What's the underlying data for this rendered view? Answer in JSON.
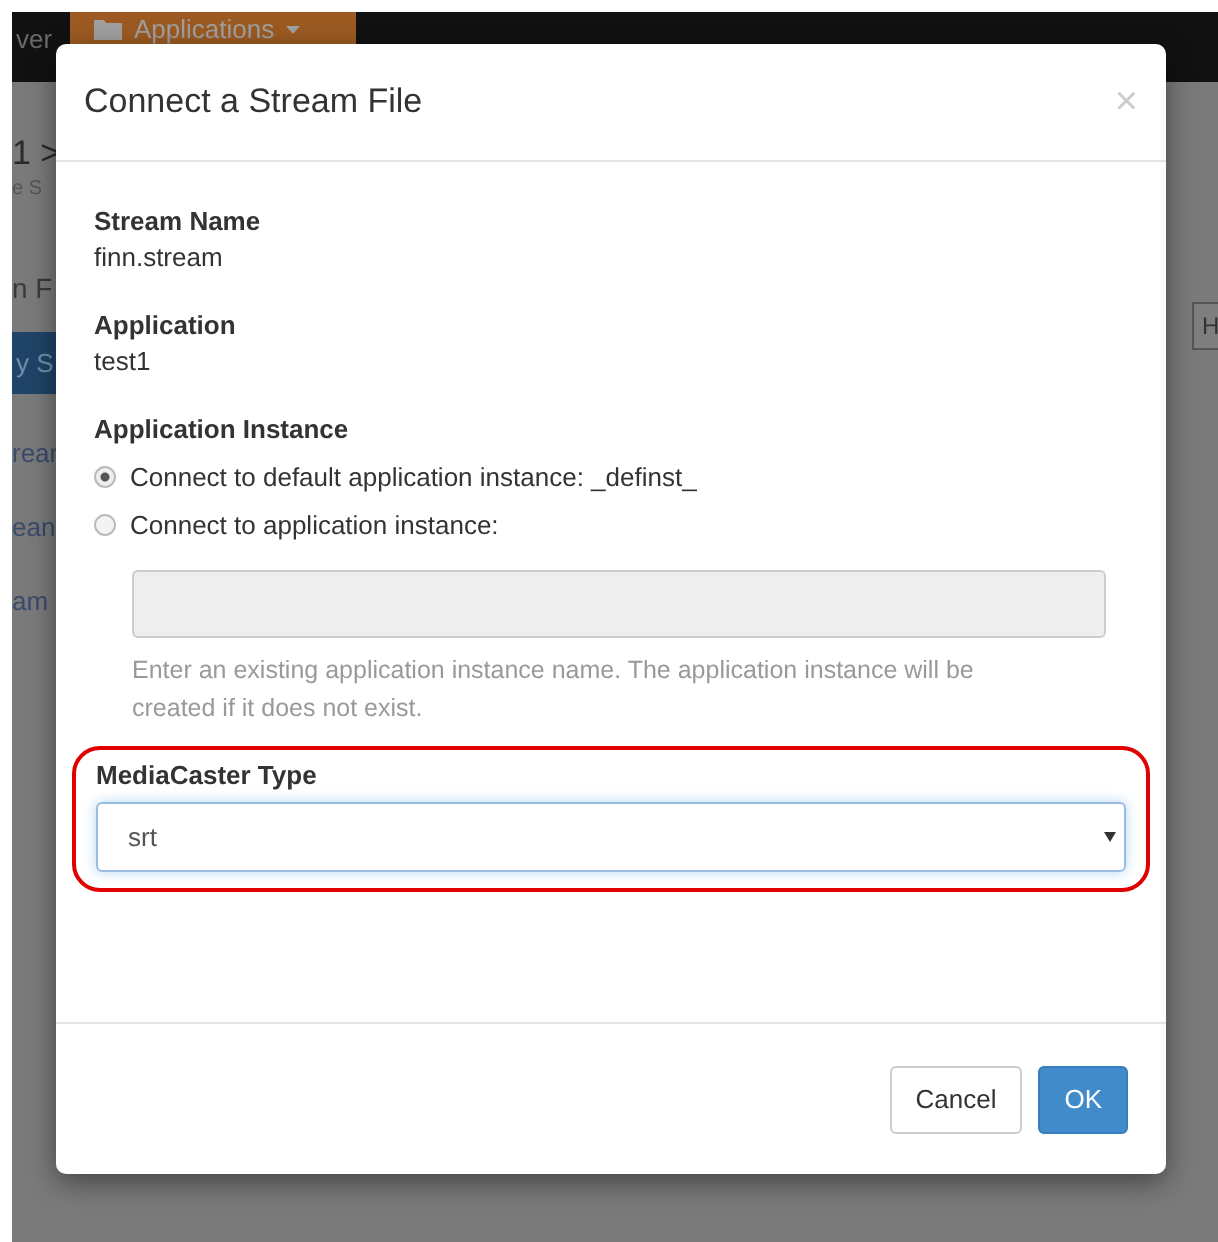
{
  "background": {
    "nav": {
      "brand_fragment": "ver",
      "menu_button": {
        "label": "Applications"
      }
    },
    "fragments": [
      {
        "kind": "heading",
        "text": "1 >"
      },
      {
        "kind": "subtext",
        "text": "e S"
      },
      {
        "kind": "title",
        "text": "n F"
      },
      {
        "kind": "button",
        "text": "y S"
      },
      {
        "kind": "row",
        "text": "rear"
      },
      {
        "kind": "row",
        "text": "ean"
      },
      {
        "kind": "row",
        "text": "am"
      }
    ],
    "side_button": {
      "label": "H"
    }
  },
  "dialog": {
    "title": "Connect a Stream File",
    "close": "×",
    "fields": [
      {
        "label": "Stream Name",
        "value": "finn.stream"
      },
      {
        "label": "Application",
        "value": "test1"
      }
    ],
    "instance": {
      "label": "Application Instance",
      "options": [
        {
          "label": "Connect to default application instance: _definst_",
          "selected": true
        },
        {
          "label": "Connect to application instance:",
          "selected": false
        }
      ],
      "input": {
        "disabled": true
      },
      "help": "Enter an existing application instance name. The application instance will be created if it does not exist."
    },
    "mediacaster": {
      "label": "MediaCaster Type",
      "value": "srt",
      "highlighted": true
    },
    "buttons": [
      {
        "label": "Cancel",
        "kind": "default"
      },
      {
        "label": "OK",
        "kind": "primary"
      }
    ]
  }
}
